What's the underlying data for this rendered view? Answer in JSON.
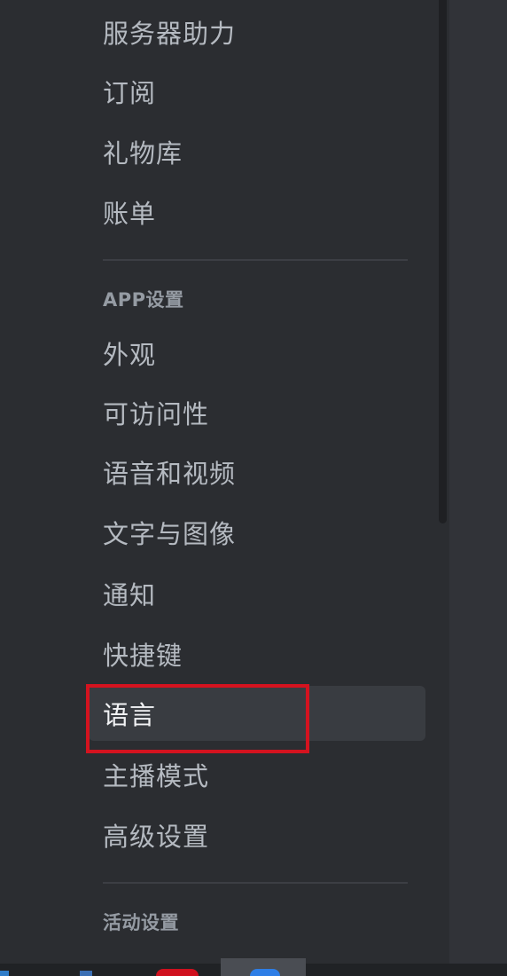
{
  "settings_nav": {
    "billing_group": [
      {
        "id": "server-boost",
        "label": "服务器助力"
      },
      {
        "id": "subscriptions",
        "label": "订阅"
      },
      {
        "id": "gift-inventory",
        "label": "礼物库"
      },
      {
        "id": "billing",
        "label": "账单"
      }
    ],
    "app_settings_header": "APP设置",
    "app_settings": [
      {
        "id": "appearance",
        "label": "外观"
      },
      {
        "id": "accessibility",
        "label": "可访问性"
      },
      {
        "id": "voice-video",
        "label": "语音和视频"
      },
      {
        "id": "text-images",
        "label": "文字与图像"
      },
      {
        "id": "notifications",
        "label": "通知"
      },
      {
        "id": "keybinds",
        "label": "快捷键"
      },
      {
        "id": "language",
        "label": "语言",
        "selected": true
      },
      {
        "id": "streamer-mode",
        "label": "主播模式"
      },
      {
        "id": "advanced",
        "label": "高级设置"
      }
    ],
    "activity_settings_header": "活动设置"
  },
  "annotation": {
    "highlight_color": "#d4131f",
    "target": "language"
  },
  "colors": {
    "sidebar_bg": "#2b2d31",
    "item_text": "#b5bac1",
    "item_selected_bg": "#393c41",
    "header_text": "#959ba3"
  }
}
